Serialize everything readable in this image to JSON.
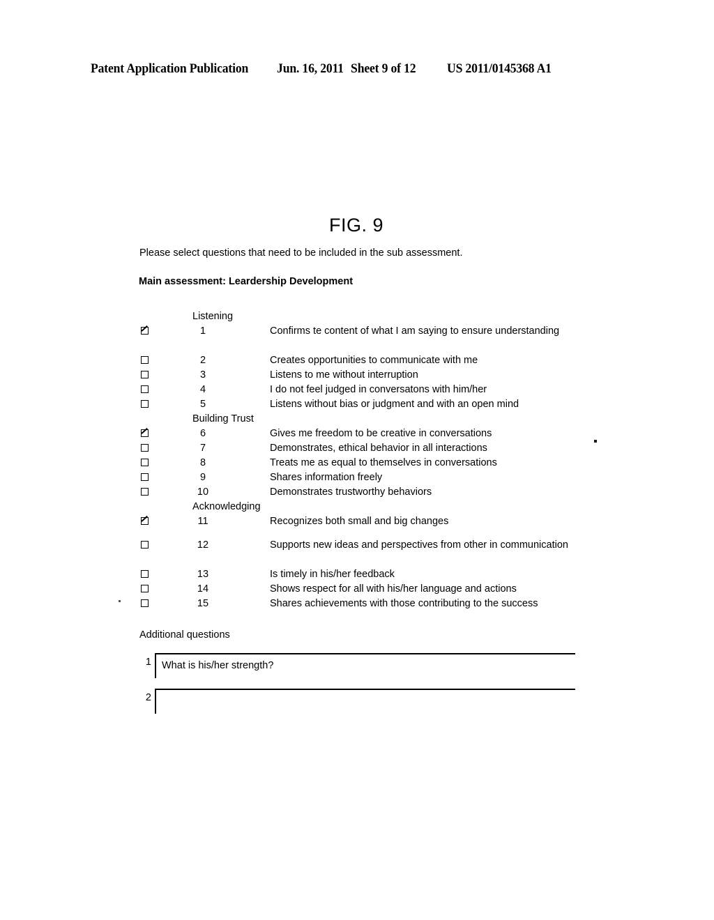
{
  "header": {
    "title": "Patent Application Publication",
    "date": "Jun. 16, 2011",
    "sheet": "Sheet 9 of 12",
    "pub_number": "US 2011/0145368 A1"
  },
  "figure": {
    "label": "FIG. 9"
  },
  "form": {
    "instruction": "Please select questions that need to be included in the sub assessment.",
    "assessment_label": "Main assessment: Leardership Development",
    "groups": [
      {
        "name": "Listening",
        "questions": [
          {
            "number": "1",
            "text": "Confirms te content of what I am saying to ensure understanding",
            "checked": true
          },
          {
            "number": "2",
            "text": "Creates opportunities to communicate with me",
            "checked": false
          },
          {
            "number": "3",
            "text": "Listens to me without interruption",
            "checked": false
          },
          {
            "number": "4",
            "text": "I do not feel judged in conversatons with him/her",
            "checked": false
          },
          {
            "number": "5",
            "text": "Listens without bias or judgment and with an open mind",
            "checked": false
          }
        ]
      },
      {
        "name": "Building Trust",
        "questions": [
          {
            "number": "6",
            "text": "Gives me freedom to be creative in conversations",
            "checked": true
          },
          {
            "number": "7",
            "text": "Demonstrates, ethical behavior in all interactions",
            "checked": false
          },
          {
            "number": "8",
            "text": "Treats me as equal to themselves in conversations",
            "checked": false
          },
          {
            "number": "9",
            "text": "Shares information freely",
            "checked": false
          },
          {
            "number": "10",
            "text": "Demonstrates trustworthy behaviors",
            "checked": false
          }
        ]
      },
      {
        "name": "Acknowledging",
        "questions": [
          {
            "number": "11",
            "text": "Recognizes both small and big changes",
            "checked": true
          },
          {
            "number": "12",
            "text": "Supports new ideas and perspectives from other in communication",
            "checked": false
          },
          {
            "number": "13",
            "text": "Is timely in his/her feedback",
            "checked": false
          },
          {
            "number": "14",
            "text": "Shows respect for all with his/her language and actions",
            "checked": false
          },
          {
            "number": "15",
            "text": "Shares achievements with those contributing to the success",
            "checked": false
          }
        ]
      }
    ],
    "additional": {
      "heading": "Additional questions",
      "fields": [
        {
          "number": "1",
          "value": "What is his/her strength?"
        },
        {
          "number": "2",
          "value": ""
        }
      ]
    }
  }
}
